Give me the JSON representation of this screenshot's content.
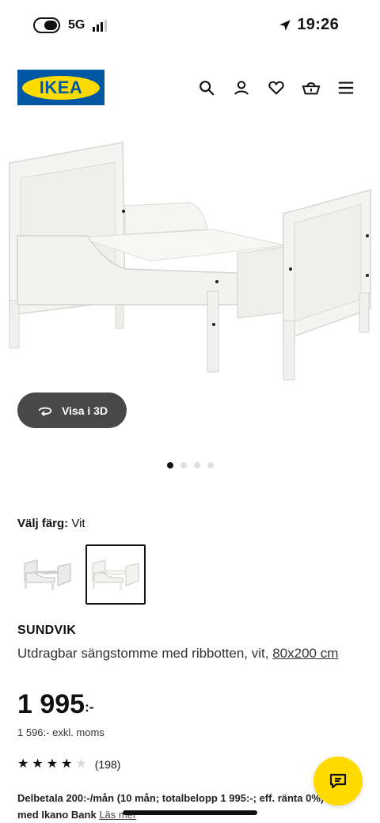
{
  "status_bar": {
    "network": "5G",
    "time": "19:26"
  },
  "header": {
    "logo_text": "IKEA",
    "icons": [
      "search-icon",
      "user-icon",
      "heart-icon",
      "basket-icon",
      "menu-icon"
    ]
  },
  "gallery": {
    "view_3d_label": "Visa i 3D",
    "total_images": 4,
    "active_index": 0
  },
  "color_selector": {
    "label": "Välj färg:",
    "value": "Vit",
    "swatches": [
      "grey-bed-swatch",
      "white-bed-swatch"
    ],
    "selected_index": 1
  },
  "product": {
    "name": "SUNDVIK",
    "description": "Utdragbar sängstomme med ribbotten, vit,",
    "size": "80x200 cm",
    "price_main": "1 995",
    "price_suffix": ":-",
    "price_ex_vat": "1 596:- exkl. moms",
    "rating": 4,
    "rating_max": 5,
    "review_count": "(198)"
  },
  "financing": {
    "text": "Delbetala 200:-/mån (10 mån; totalbelopp 1 995:-; eff. ränta 0%) med Ikano Bank",
    "link_label": "Läs mer"
  },
  "colors": {
    "ikea_blue": "#0058a3",
    "ikea_yellow": "#ffdb00",
    "button_dark": "#484848"
  }
}
